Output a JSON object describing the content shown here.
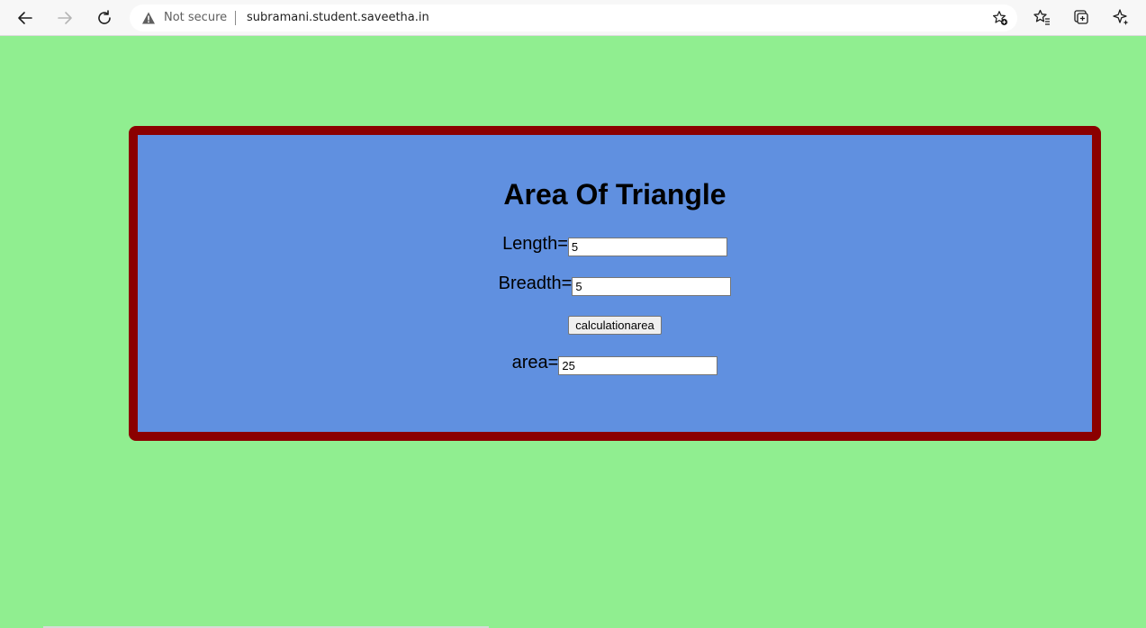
{
  "browser": {
    "security_label": "Not secure",
    "url": "subramani.student.saveetha.in",
    "icons": {
      "back": "back-arrow-icon",
      "forward": "forward-arrow-icon",
      "refresh": "refresh-icon",
      "warning": "warning-icon",
      "add_favorite": "add-favorite-icon",
      "favorites": "favorites-icon",
      "collections": "collections-icon",
      "copilot": "copilot-icon"
    }
  },
  "page": {
    "title": "Area Of Triangle",
    "length_label": "Length=",
    "length_value": "5",
    "breadth_label": "Breadth=",
    "breadth_value": "5",
    "button_label": "calculationarea",
    "area_label": "area=",
    "area_value": "25"
  },
  "colors": {
    "page_background": "#90ee90",
    "box_background": "#6090e0",
    "box_border": "#8b0000"
  }
}
